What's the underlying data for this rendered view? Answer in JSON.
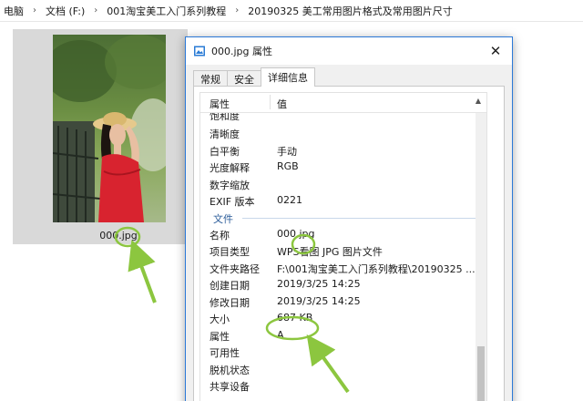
{
  "address_bar": {
    "crumbs": [
      "电脑",
      "文档 (F:)",
      "001淘宝美工入门系列教程",
      "20190325 美工常用图片格式及常用图片尺寸"
    ]
  },
  "file_tile": {
    "file_name": "000.jpg"
  },
  "properties_window": {
    "title": "000.jpg 属性",
    "tabs": [
      {
        "label": "常规",
        "active": false
      },
      {
        "label": "安全",
        "active": false
      },
      {
        "label": "详细信息",
        "active": true
      }
    ],
    "column_headers": {
      "property": "属性",
      "value": "值"
    },
    "rows_top": [
      {
        "name": "饱和度",
        "value": ""
      },
      {
        "name": "清晰度",
        "value": ""
      },
      {
        "name": "白平衡",
        "value": "手动"
      },
      {
        "name": "光度解释",
        "value": "RGB"
      },
      {
        "name": "数字缩放",
        "value": ""
      },
      {
        "name": "EXIF 版本",
        "value": "0221"
      }
    ],
    "section_label": "文件",
    "rows_file": [
      {
        "name": "名称",
        "value": "000.jpg"
      },
      {
        "name": "项目类型",
        "value": "WPS看图 JPG 图片文件"
      },
      {
        "name": "文件夹路径",
        "value": "F:\\001淘宝美工入门系列教程\\20190325 ..."
      },
      {
        "name": "创建日期",
        "value": "2019/3/25 14:25"
      },
      {
        "name": "修改日期",
        "value": "2019/3/25 14:25"
      },
      {
        "name": "大小",
        "value": "687 KB"
      },
      {
        "name": "属性",
        "value": "A"
      },
      {
        "name": "可用性",
        "value": ""
      },
      {
        "name": "脱机状态",
        "value": ""
      },
      {
        "name": "共享设备",
        "value": ""
      }
    ]
  },
  "colors": {
    "annotation": "#8cc63f",
    "window_border": "#2b79d8",
    "section_label": "#2c5d9a"
  },
  "icons": [
    "chevron-right-icon",
    "image-file-icon",
    "close-icon",
    "sort-up-icon"
  ]
}
